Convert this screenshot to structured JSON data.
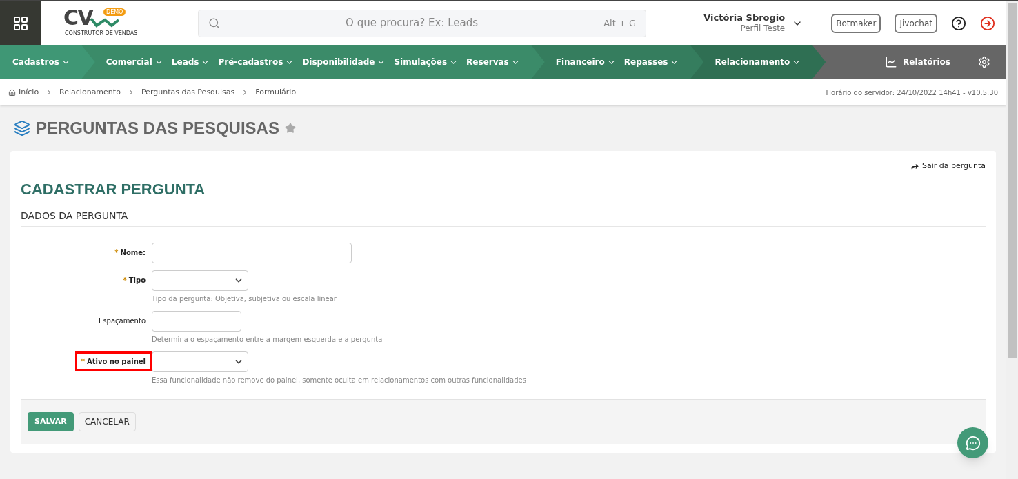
{
  "header": {
    "logo_text": "CV",
    "logo_badge": "DEMO",
    "logo_subtitle": "CONSTRUTOR DE VENDAS",
    "search": {
      "placeholder": "O que procura? Ex: Leads",
      "shortcut": "Alt + G"
    },
    "user": {
      "name": "Victória Sbrogio",
      "profile": "Perfil Teste"
    },
    "buttons": [
      "Botmaker",
      "Jivochat"
    ]
  },
  "nav": {
    "groups": [
      {
        "color": "#3f9775",
        "items": [
          "Cadastros"
        ]
      },
      {
        "color": "#3b8b69",
        "items": [
          "Comercial",
          "Leads",
          "Pré-cadastros",
          "Disponibilidade",
          "Simulações",
          "Reservas"
        ]
      },
      {
        "color": "#357d5e",
        "items": [
          "Financeiro",
          "Repasses"
        ]
      },
      {
        "color": "#2f6f53",
        "items": [
          "Relacionamento"
        ]
      }
    ],
    "reports": "Relatórios"
  },
  "breadcrumb": [
    "Início",
    "Relacionamento",
    "Perguntas das Pesquisas",
    "Formulário"
  ],
  "server_time": "Horário do servidor: 24/10/2022 14h41 - v10.5.30",
  "page_title": "PERGUNTAS DAS PESQUISAS",
  "form": {
    "exit_link": "Sair da pergunta",
    "title": "CADASTRAR PERGUNTA",
    "section": "DADOS DA PERGUNTA",
    "fields": [
      {
        "kind": "text",
        "label": "Nome:",
        "required": true,
        "mark": "*",
        "highlighted": false
      },
      {
        "kind": "select",
        "label": "Tipo",
        "required": true,
        "mark": "*",
        "highlighted": false,
        "hint": "Tipo da pergunta: Objetiva, subjetiva ou escala linear"
      },
      {
        "kind": "number",
        "label": "Espaçamento",
        "required": false,
        "highlighted": false,
        "hint": "Determina o espaçamento entre a margem esquerda e a pergunta"
      },
      {
        "kind": "select",
        "label": "Ativo no painel",
        "required": true,
        "mark": "*",
        "highlighted": true,
        "hint": "Essa funcionalidade não remove do painel, somente oculta em relacionamentos com outras funcionalidades"
      }
    ],
    "actions": [
      {
        "kind": "primary",
        "label": "SALVAR"
      },
      {
        "kind": "secondary",
        "label": "CANCELAR"
      }
    ]
  }
}
